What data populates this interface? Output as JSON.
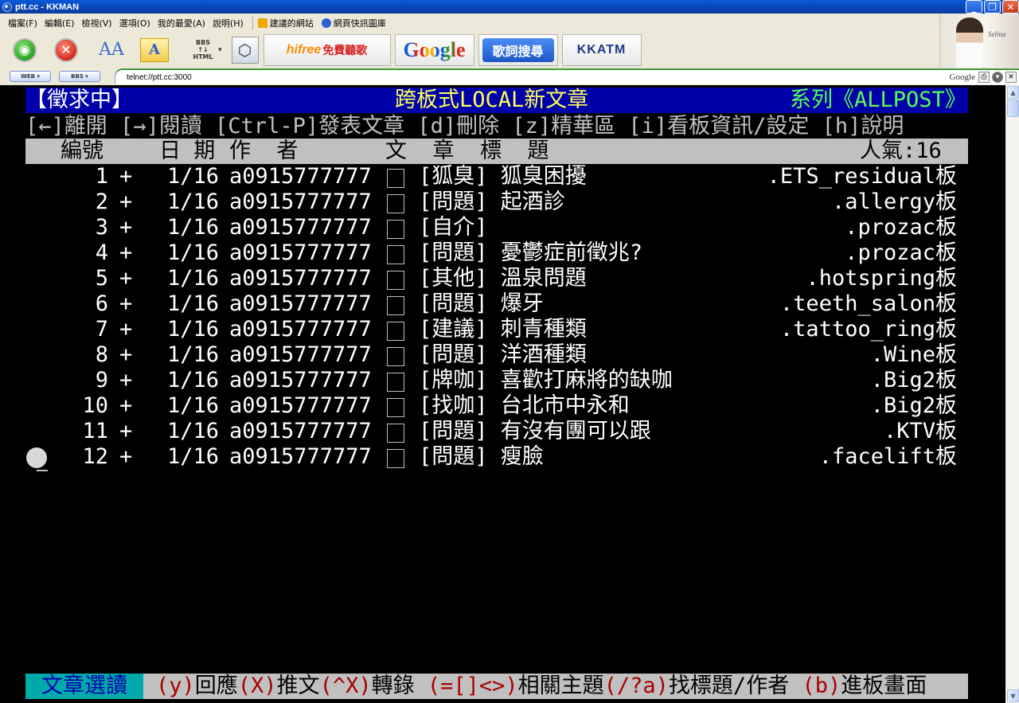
{
  "window": {
    "title": "ptt.cc - KKMAN",
    "minimize": "_",
    "maximize": "❐",
    "close": "✕"
  },
  "menu": {
    "items": [
      "檔案(F)",
      "編輯(E)",
      "檢視(V)",
      "選項(O)",
      "我的最愛(A)",
      "說明(H)"
    ],
    "favorites": [
      {
        "label": "建議的網站",
        "color": "#f0a800"
      },
      {
        "label": "網頁快訊圖庫",
        "color": "#2a63d4"
      }
    ]
  },
  "toolbar": {
    "go_icon": "go-icon",
    "stop_icon": "stop-icon",
    "font_a_large": "AA",
    "font_a_box": "A",
    "bbs_html_line1": "BBS",
    "bbs_html_line2": "↑↓",
    "bbs_html_line3": "HTML",
    "bbs_html_arrow": "▾",
    "hifree_latin": "hifree",
    "hifree_cn": "免費聽歌",
    "google": "Google",
    "lyrics": "歌詞搜尋",
    "kkatm": "KKATM"
  },
  "ad": {
    "name": "Selina"
  },
  "address": {
    "web_mode": "WEB ▾",
    "bbs_mode": "BBS ▾",
    "url": "telnet://ptt.cc:3000",
    "search_engine": "Google"
  },
  "terminal": {
    "header": {
      "left": "【徵求中】",
      "center": "跨板式LOCAL新文章",
      "right": "系列《ALLPOST》"
    },
    "help": "[←]離開 [→]閱讀 [Ctrl-P]發表文章 [d]刪除 [z]精華區 [i]看板資訊/設定 [h]說明",
    "columns": {
      "number": "編號",
      "date": "日 期",
      "author": "作  者",
      "title": "文  章  標  題",
      "popularity": "人氣:16"
    },
    "rows": [
      {
        "num": "1",
        "mark": "+",
        "date": "1/16",
        "author": "a0915777777",
        "title": "[狐臭] 狐臭困擾",
        "board": ".ETS_residual板"
      },
      {
        "num": "2",
        "mark": "+",
        "date": "1/16",
        "author": "a0915777777",
        "title": "[問題] 起酒診",
        "board": ".allergy板"
      },
      {
        "num": "3",
        "mark": "+",
        "date": "1/16",
        "author": "a0915777777",
        "title": "[自介]",
        "board": ".prozac板"
      },
      {
        "num": "4",
        "mark": "+",
        "date": "1/16",
        "author": "a0915777777",
        "title": "[問題] 憂鬱症前徵兆?",
        "board": ".prozac板"
      },
      {
        "num": "5",
        "mark": "+",
        "date": "1/16",
        "author": "a0915777777",
        "title": "[其他] 溫泉問題",
        "board": ".hotspring板"
      },
      {
        "num": "6",
        "mark": "+",
        "date": "1/16",
        "author": "a0915777777",
        "title": "[問題] 爆牙",
        "board": ".teeth_salon板"
      },
      {
        "num": "7",
        "mark": "+",
        "date": "1/16",
        "author": "a0915777777",
        "title": "[建議] 刺青種類",
        "board": ".tattoo_ring板"
      },
      {
        "num": "8",
        "mark": "+",
        "date": "1/16",
        "author": "a0915777777",
        "title": "[問題] 洋酒種類",
        "board": ".Wine板"
      },
      {
        "num": "9",
        "mark": "+",
        "date": "1/16",
        "author": "a0915777777",
        "title": "[牌咖] 喜歡打麻將的缺咖",
        "board": ".Big2板"
      },
      {
        "num": "10",
        "mark": "+",
        "date": "1/16",
        "author": "a0915777777",
        "title": "[找咖] 台北市中永和",
        "board": ".Big2板"
      },
      {
        "num": "11",
        "mark": "+",
        "date": "1/16",
        "author": "a0915777777",
        "title": "[問題] 有沒有團可以跟",
        "board": ".KTV板"
      },
      {
        "num": "12",
        "mark": "+",
        "date": "1/16",
        "author": "a0915777777",
        "title": "[問題] 瘦臉",
        "board": ".facelift板"
      }
    ],
    "status": {
      "mode": "文章選讀",
      "keys": [
        {
          "key": "(y)",
          "label": "回應"
        },
        {
          "key": "(X)",
          "label": "推文"
        },
        {
          "key": "(^X)",
          "label": "轉錄 "
        },
        {
          "key": "(=[]<>)",
          "label": "相關主題"
        },
        {
          "key": "(/?a)",
          "label": "找標題/作者 "
        },
        {
          "key": "(b)",
          "label": "進板畫面"
        }
      ]
    }
  },
  "scrollbar": {
    "up": "▲",
    "down": "▼"
  }
}
